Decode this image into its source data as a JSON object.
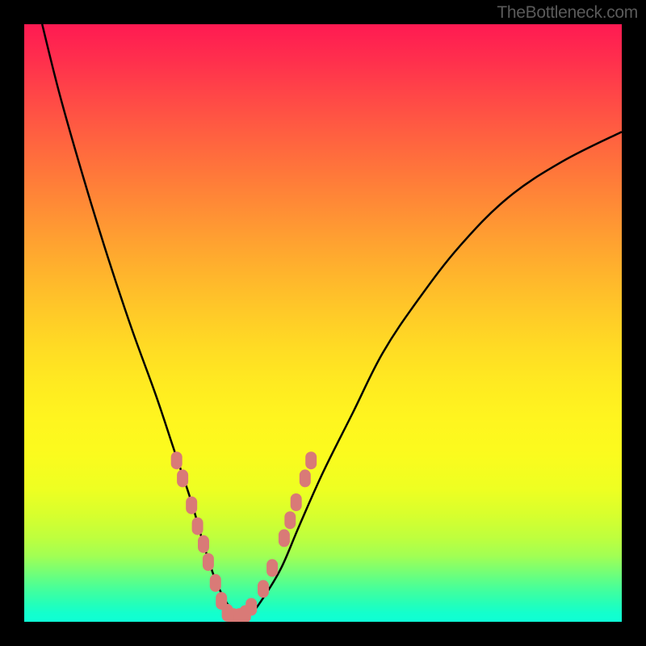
{
  "watermark_text": "TheBottleneck.com",
  "chart_data": {
    "type": "line",
    "title": "",
    "xlabel": "",
    "ylabel": "",
    "xlim": [
      0,
      100
    ],
    "ylim": [
      0,
      100
    ],
    "background": "rainbow-gradient-red-to-green",
    "note": "V-shaped bottleneck curve. Axes are unlabeled in the source image; x/y are normalized 0–100. Gradient encodes bottleneck severity (red=high, green=low). Curve minimum near x≈35.",
    "series": [
      {
        "name": "bottleneck-curve",
        "x": [
          3,
          6,
          10,
          14,
          18,
          22,
          25,
          28,
          30,
          32,
          34,
          36,
          38,
          40,
          43,
          46,
          50,
          55,
          60,
          66,
          73,
          81,
          90,
          100
        ],
        "y": [
          100,
          88,
          74,
          61,
          49,
          38,
          29,
          20,
          13,
          7,
          3,
          1,
          1.5,
          4,
          9,
          16,
          25,
          35,
          45,
          54,
          63,
          71,
          77,
          82
        ]
      }
    ],
    "data_points": [
      {
        "x": 25.5,
        "y": 27
      },
      {
        "x": 26.5,
        "y": 24
      },
      {
        "x": 28.0,
        "y": 19.5
      },
      {
        "x": 29.0,
        "y": 16
      },
      {
        "x": 30.0,
        "y": 13
      },
      {
        "x": 30.8,
        "y": 10
      },
      {
        "x": 32.0,
        "y": 6.5
      },
      {
        "x": 33.0,
        "y": 3.5
      },
      {
        "x": 34.0,
        "y": 1.5
      },
      {
        "x": 35.0,
        "y": 0.8
      },
      {
        "x": 36.0,
        "y": 0.8
      },
      {
        "x": 37.0,
        "y": 1.3
      },
      {
        "x": 38.0,
        "y": 2.5
      },
      {
        "x": 40.0,
        "y": 5.5
      },
      {
        "x": 41.5,
        "y": 9
      },
      {
        "x": 43.5,
        "y": 14
      },
      {
        "x": 44.5,
        "y": 17
      },
      {
        "x": 45.5,
        "y": 20
      },
      {
        "x": 47.0,
        "y": 24
      },
      {
        "x": 48.0,
        "y": 27
      }
    ]
  }
}
